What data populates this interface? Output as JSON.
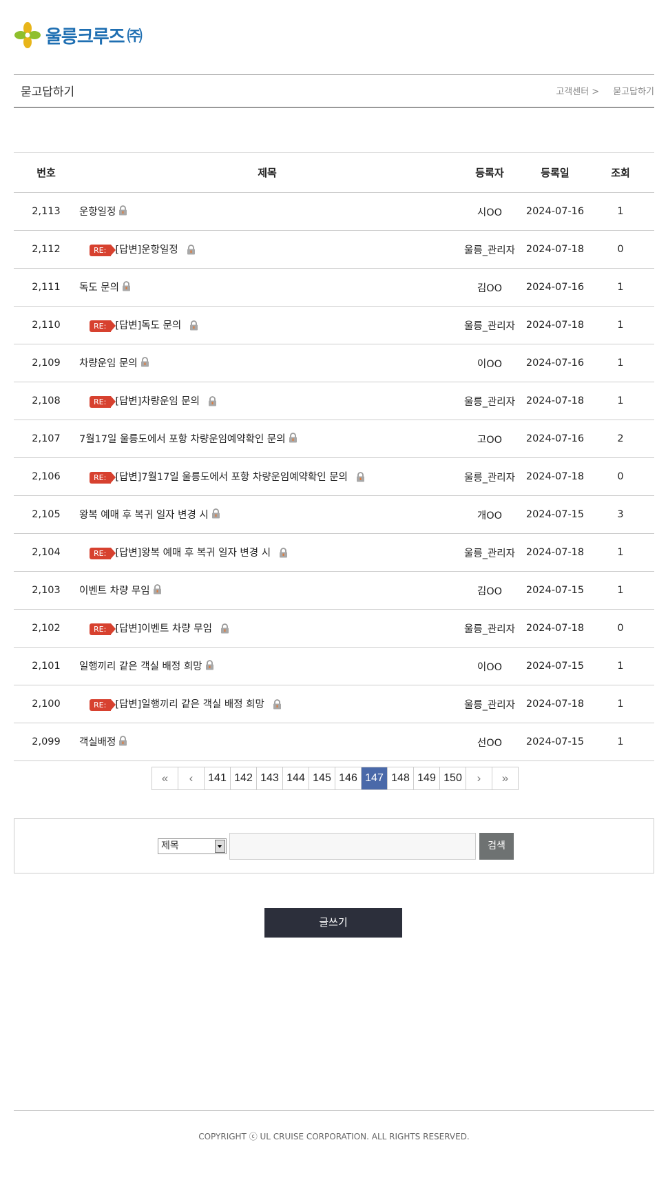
{
  "brand": {
    "name": "울릉크루즈",
    "suffix": "㈜"
  },
  "header": {
    "title": "묻고답하기",
    "breadcrumb": [
      "고객센터 >",
      "묻고답하기"
    ]
  },
  "table": {
    "columns": [
      "번호",
      "제목",
      "등록자",
      "등록일",
      "조회"
    ],
    "reply_badge": "RE:",
    "rows": [
      {
        "num": "2,113",
        "title": "운항일정",
        "writer": "시OO",
        "date": "2024-07-16",
        "views": "1",
        "reply": false
      },
      {
        "num": "2,112",
        "title": "[답변]운항일정",
        "writer": "울릉_관리자",
        "date": "2024-07-18",
        "views": "0",
        "reply": true
      },
      {
        "num": "2,111",
        "title": "독도 문의",
        "writer": "김OO",
        "date": "2024-07-16",
        "views": "1",
        "reply": false
      },
      {
        "num": "2,110",
        "title": "[답변]독도 문의",
        "writer": "울릉_관리자",
        "date": "2024-07-18",
        "views": "1",
        "reply": true
      },
      {
        "num": "2,109",
        "title": "차량운임 문의",
        "writer": "이OO",
        "date": "2024-07-16",
        "views": "1",
        "reply": false
      },
      {
        "num": "2,108",
        "title": "[답변]차량운임 문의",
        "writer": "울릉_관리자",
        "date": "2024-07-18",
        "views": "1",
        "reply": true
      },
      {
        "num": "2,107",
        "title": "7월17일 울릉도에서 포항 차량운임예약확인 문의",
        "writer": "고OO",
        "date": "2024-07-16",
        "views": "2",
        "reply": false
      },
      {
        "num": "2,106",
        "title": "[답변]7월17일 울릉도에서 포항 차량운임예약확인 문의",
        "writer": "울릉_관리자",
        "date": "2024-07-18",
        "views": "0",
        "reply": true
      },
      {
        "num": "2,105",
        "title": "왕복 예매 후 복귀 일자 변경 시",
        "writer": "개OO",
        "date": "2024-07-15",
        "views": "3",
        "reply": false
      },
      {
        "num": "2,104",
        "title": "[답변]왕복 예매 후 복귀 일자 변경 시",
        "writer": "울릉_관리자",
        "date": "2024-07-18",
        "views": "1",
        "reply": true
      },
      {
        "num": "2,103",
        "title": "이벤트 차량 무임",
        "writer": "김OO",
        "date": "2024-07-15",
        "views": "1",
        "reply": false
      },
      {
        "num": "2,102",
        "title": "[답변]이벤트 차량 무임",
        "writer": "울릉_관리자",
        "date": "2024-07-18",
        "views": "0",
        "reply": true
      },
      {
        "num": "2,101",
        "title": "일행끼리 같은 객실 배정 희망",
        "writer": "이OO",
        "date": "2024-07-15",
        "views": "1",
        "reply": false
      },
      {
        "num": "2,100",
        "title": "[답변]일행끼리 같은 객실 배정 희망",
        "writer": "울릉_관리자",
        "date": "2024-07-18",
        "views": "1",
        "reply": true
      },
      {
        "num": "2,099",
        "title": "객실배정",
        "writer": "선OO",
        "date": "2024-07-15",
        "views": "1",
        "reply": false
      }
    ]
  },
  "pagination": {
    "first": "«",
    "prev": "‹",
    "pages": [
      "141",
      "142",
      "143",
      "144",
      "145",
      "146",
      "147",
      "148",
      "149",
      "150"
    ],
    "current": "147",
    "next": "›",
    "last": "»"
  },
  "search": {
    "field_selected": "제목",
    "query": "",
    "button": "검색"
  },
  "write_button": "글쓰기",
  "footer": {
    "copyright": "COPYRIGHT ⓒ UL CRUISE CORPORATION. ALL RIGHTS RESERVED."
  },
  "colors": {
    "brand": "#1f6fb2",
    "reply_badge": "#d7412f",
    "active_page": "#4a69a9",
    "write_button": "#2c2f3b"
  }
}
